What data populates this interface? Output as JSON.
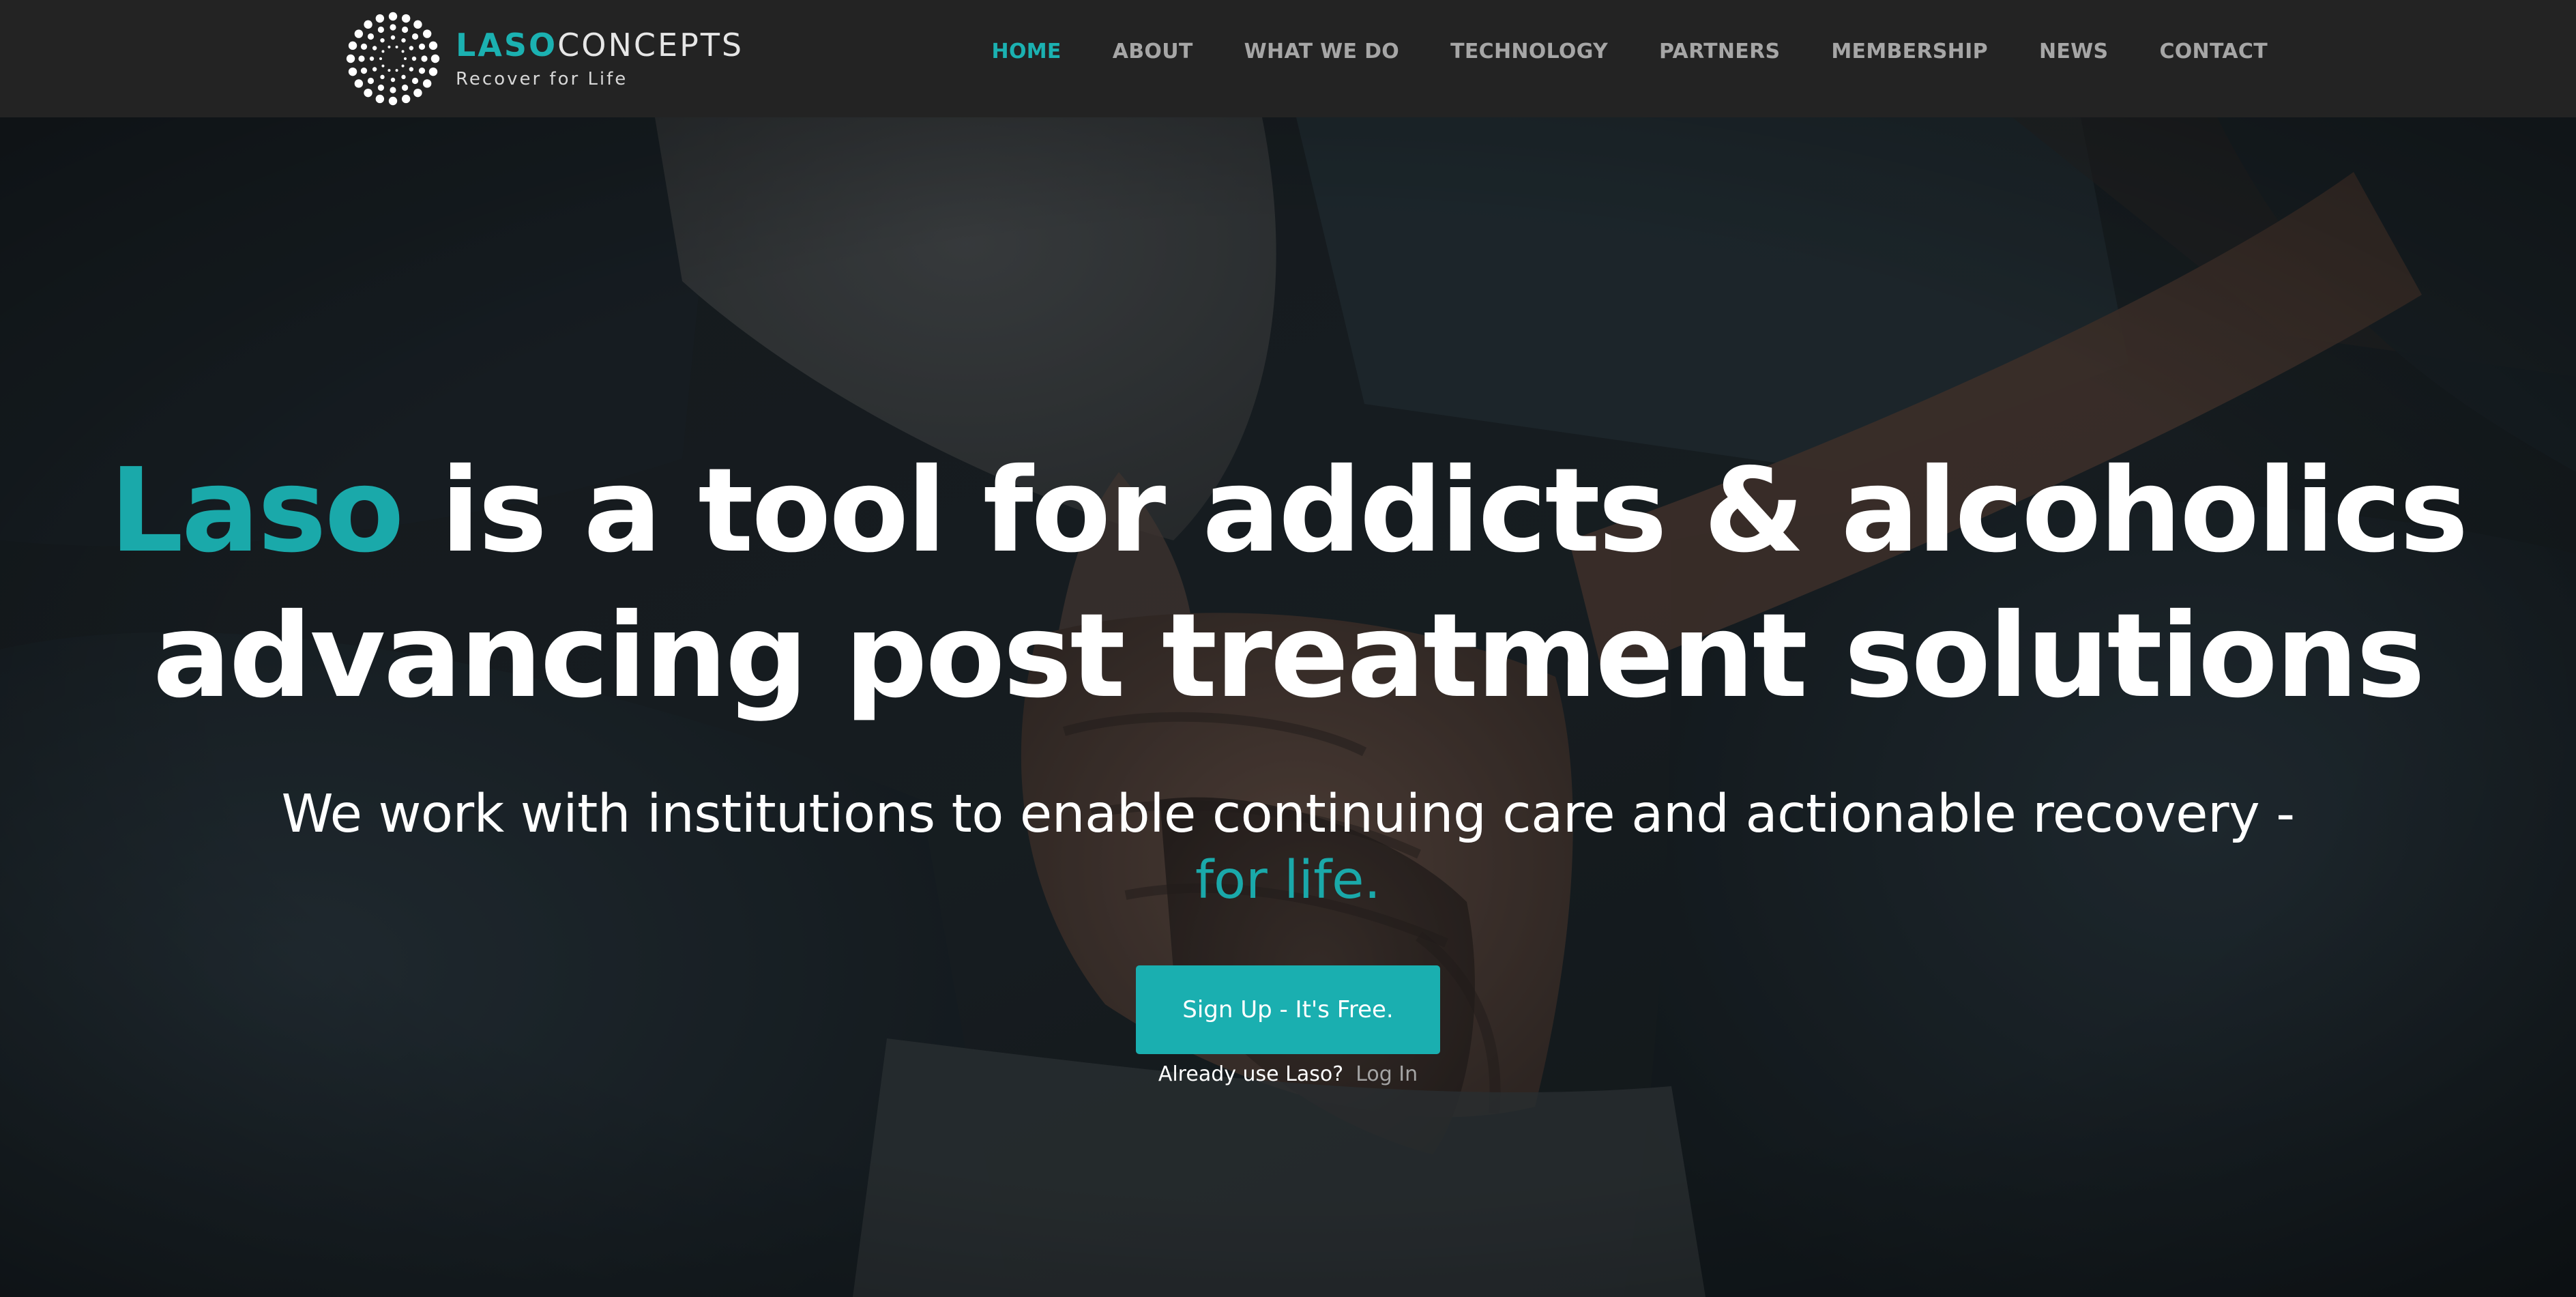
{
  "brand": {
    "name_part1": "LASO",
    "name_part2": "CONCEPTS",
    "tagline": "Recover for Life",
    "logo_icon": "dotted-circle-logo-icon",
    "accent_color": "#1bb1b1"
  },
  "nav": {
    "items": [
      {
        "label": "HOME",
        "active": true
      },
      {
        "label": "ABOUT",
        "active": false
      },
      {
        "label": "WHAT WE DO",
        "active": false
      },
      {
        "label": "TECHNOLOGY",
        "active": false
      },
      {
        "label": "PARTNERS",
        "active": false
      },
      {
        "label": "MEMBERSHIP",
        "active": false
      },
      {
        "label": "NEWS",
        "active": false
      },
      {
        "label": "CONTACT",
        "active": false
      }
    ]
  },
  "hero": {
    "headline_accent": "Laso",
    "headline_line1_rest": " is a tool for addicts & alcoholics",
    "headline_line2": "advancing post treatment solutions",
    "subheading_line1": "We work with institutions to enable continuing care and actionable recovery -",
    "subheading_line2": "for life.",
    "cta_label": "Sign Up - It's Free.",
    "login_prompt": "Already use Laso?",
    "login_link": "Log In",
    "background_image": "hands-holding-photo"
  }
}
